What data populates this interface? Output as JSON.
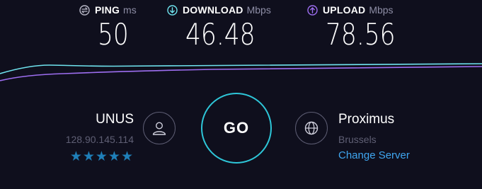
{
  "metrics": {
    "ping": {
      "label": "PING",
      "unit": "ms",
      "value": "50",
      "icon": "ping-icon"
    },
    "download": {
      "label": "DOWNLOAD",
      "unit": "Mbps",
      "value": "46.48",
      "icon": "download-arrow-icon"
    },
    "upload": {
      "label": "UPLOAD",
      "unit": "Mbps",
      "value": "78.56",
      "icon": "upload-arrow-icon"
    }
  },
  "user": {
    "isp": "UNUS",
    "ip": "128.90.145.114",
    "rating_stars": "★★★★★",
    "icon": "user-icon"
  },
  "go_button": {
    "label": "GO"
  },
  "server": {
    "name": "Proximus",
    "location": "Brussels",
    "change_label": "Change Server",
    "icon": "globe-icon"
  },
  "colors": {
    "background": "#0f0f1d",
    "download_line": "#6fe3ee",
    "upload_line": "#9d6ef0",
    "go_ring": "#2ec6d8",
    "link": "#3fa6f0",
    "star": "#1f7fb8"
  }
}
